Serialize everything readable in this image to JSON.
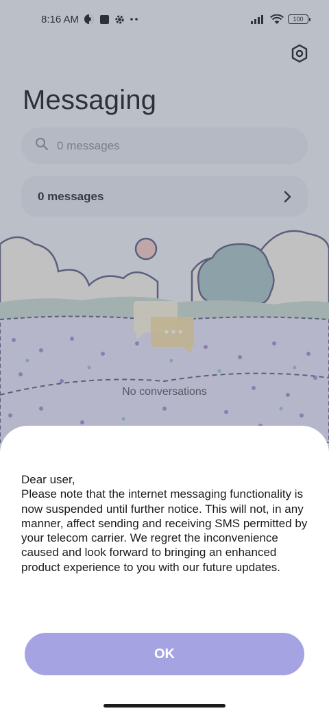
{
  "status_bar": {
    "time": "8:16 AM",
    "battery": "100",
    "left_icons": [
      "vpn-icon",
      "square-icon",
      "gear-icon",
      "more-dots-icon"
    ],
    "right_icons": [
      "signal-icon",
      "wifi-icon",
      "battery-icon"
    ]
  },
  "header": {
    "title": "Messaging",
    "settings_icon": "settings-hexagon-icon"
  },
  "search": {
    "placeholder": "0 messages"
  },
  "messages_row": {
    "label": "0 messages"
  },
  "empty_state": {
    "text": "No conversations"
  },
  "dialog": {
    "greeting": "Dear user,",
    "message": "Please note that the internet messaging functionality is now suspended until further notice. This will not, in any manner, affect sending and receiving SMS permitted by your telecom carrier. We regret the inconvenience caused and look forward to bringing an enhanced product experience to you with our future updates.",
    "ok_label": "OK"
  },
  "colors": {
    "accent": "#a5a3e1",
    "background": "#eeeff3",
    "sheet": "#ffffff"
  }
}
